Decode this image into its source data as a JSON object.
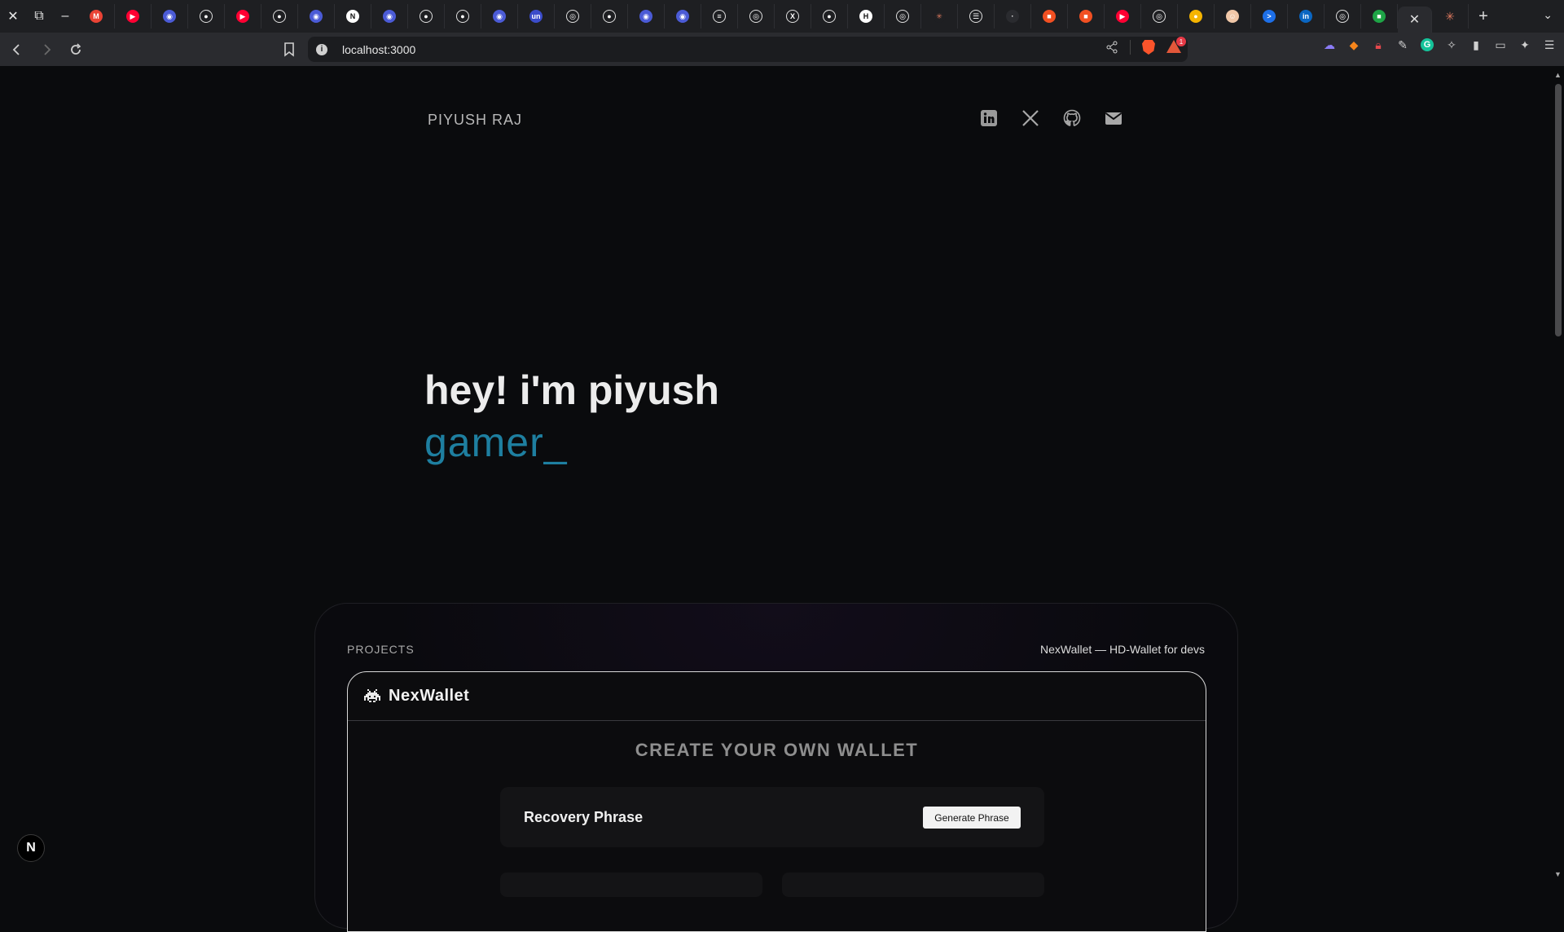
{
  "browser": {
    "url": "localhost:3000",
    "rewards_badge": "1",
    "tab_favicons": [
      "gmail",
      "youtube",
      "circle",
      "github",
      "youtube",
      "github",
      "circle",
      "notion",
      "circle",
      "github",
      "github",
      "circle",
      "un",
      "target",
      "github",
      "circle",
      "circle",
      "stack",
      "target",
      "x",
      "github",
      "hackerrank",
      "target",
      "claude",
      "list",
      "dark",
      "microsoft",
      "microsoft",
      "youtube",
      "target",
      "bulb",
      "avatar",
      "terminal",
      "linkedin",
      "target",
      "green"
    ],
    "new_tab_label": "+"
  },
  "site": {
    "brand": "PIYUSH RAJ",
    "hero_title": "hey! i'm piyush",
    "hero_sub": "gamer_",
    "projects_label": "PROJECTS",
    "projects_caption": "NexWallet — HD-Wallet for devs",
    "app": {
      "name": "NexWallet",
      "heading": "CREATE YOUR OWN WALLET",
      "recovery_title": "Recovery Phrase",
      "generate_label": "Generate Phrase"
    },
    "next_badge": "N"
  }
}
